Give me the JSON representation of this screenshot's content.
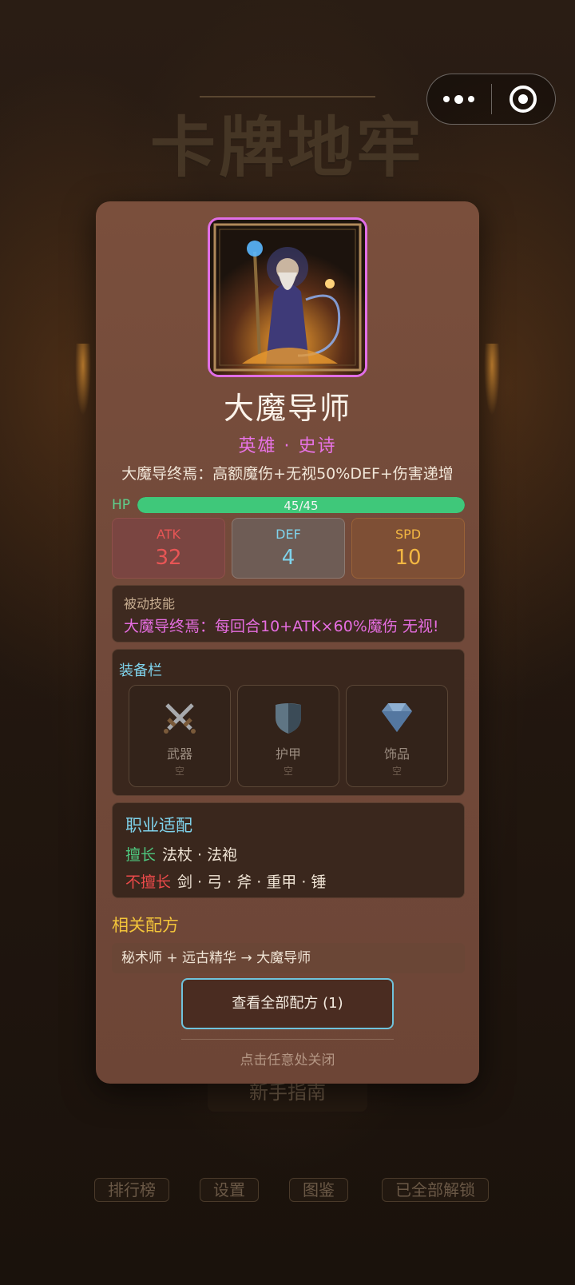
{
  "background": {
    "title": "卡牌地牢",
    "guide_button": "新手指南",
    "nav": [
      "排行榜",
      "设置",
      "图鉴",
      "已全部解锁"
    ]
  },
  "capsule": {
    "more_icon": "more-dots-icon",
    "close_icon": "target-close-icon"
  },
  "card": {
    "name": "大魔导师",
    "rarity": "英雄 · 史诗",
    "rarity_color": "#e873e6",
    "description": "大魔导终焉：高额魔伤+无视50%DEF+伤害递增",
    "hp": {
      "label": "HP",
      "current": 45,
      "max": 45,
      "text": "45/45"
    },
    "stats": {
      "atk": {
        "label": "ATK",
        "value": "32",
        "color": "#e85555"
      },
      "def": {
        "label": "DEF",
        "value": "4",
        "color": "#7fd3ec"
      },
      "spd": {
        "label": "SPD",
        "value": "10",
        "color": "#f2b642"
      }
    },
    "passive": {
      "title": "被动技能",
      "text": "大魔导终焉：每回合10+ATK×60%魔伤 无视!"
    },
    "equipment": {
      "title": "装备栏",
      "slots": [
        {
          "name": "武器",
          "status": "空",
          "icon": "crossed-swords-icon"
        },
        {
          "name": "护甲",
          "status": "空",
          "icon": "shield-icon"
        },
        {
          "name": "饰品",
          "status": "空",
          "icon": "gem-icon"
        }
      ]
    },
    "class_fit": {
      "title": "职业适配",
      "good_label": "擅长",
      "good_items": "法杖 · 法袍",
      "bad_label": "不擅长",
      "bad_items": "剑 · 弓 · 斧 · 重甲 · 锤"
    },
    "recipes": {
      "title": "相关配方",
      "items": [
        "秘术师 + 远古精华 → 大魔导师"
      ],
      "view_all_button": "查看全部配方 (1)"
    },
    "close_hint": "点击任意处关闭"
  }
}
